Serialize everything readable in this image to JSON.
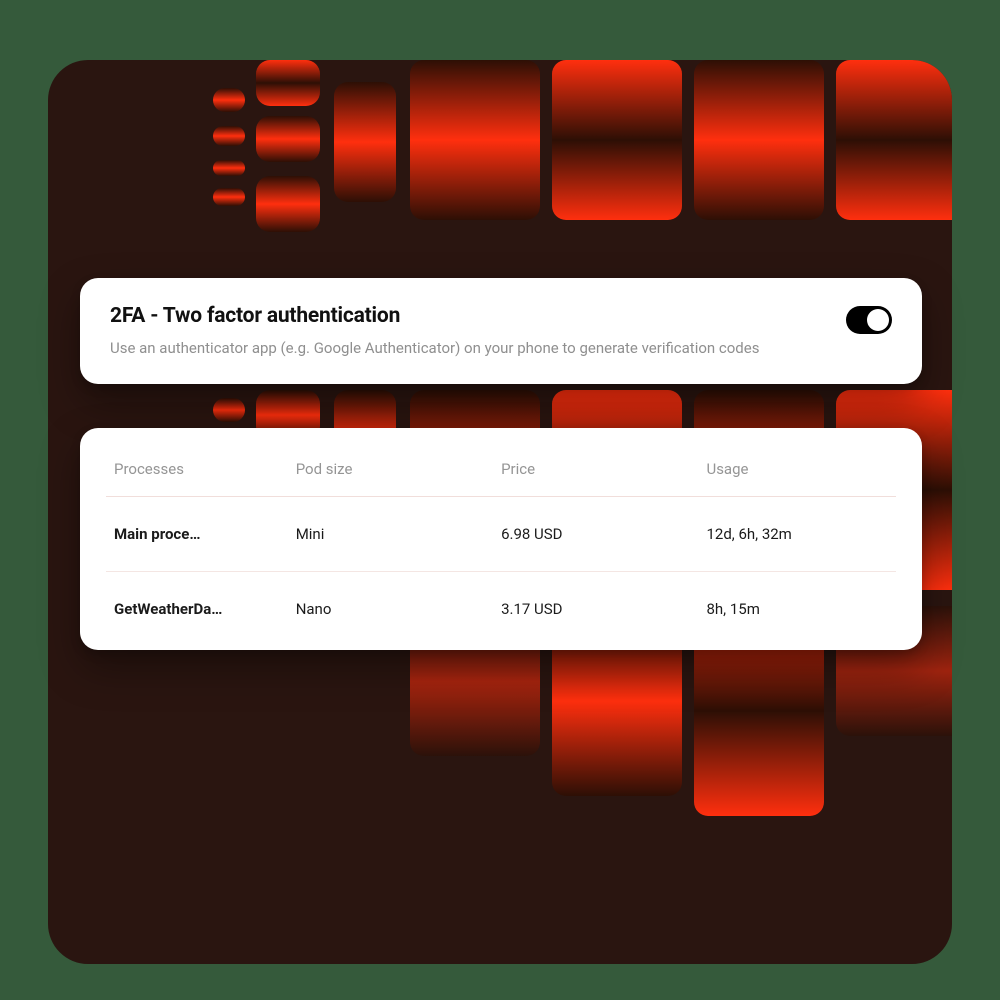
{
  "tfa": {
    "title": "2FA - Two factor authentication",
    "description": "Use an authenticator app (e.g. Google Authenticator) on your phone to generate verification codes",
    "enabled": true
  },
  "table": {
    "headers": {
      "processes": "Processes",
      "pod_size": "Pod size",
      "price": "Price",
      "usage": "Usage"
    },
    "rows": [
      {
        "process": "Main proce…",
        "pod_size": "Mini",
        "price": "6.98 USD",
        "usage": "12d, 6h, 32m"
      },
      {
        "process": "GetWeatherDa…",
        "pod_size": "Nano",
        "price": "3.17 USD",
        "usage": "8h, 15m"
      }
    ]
  }
}
